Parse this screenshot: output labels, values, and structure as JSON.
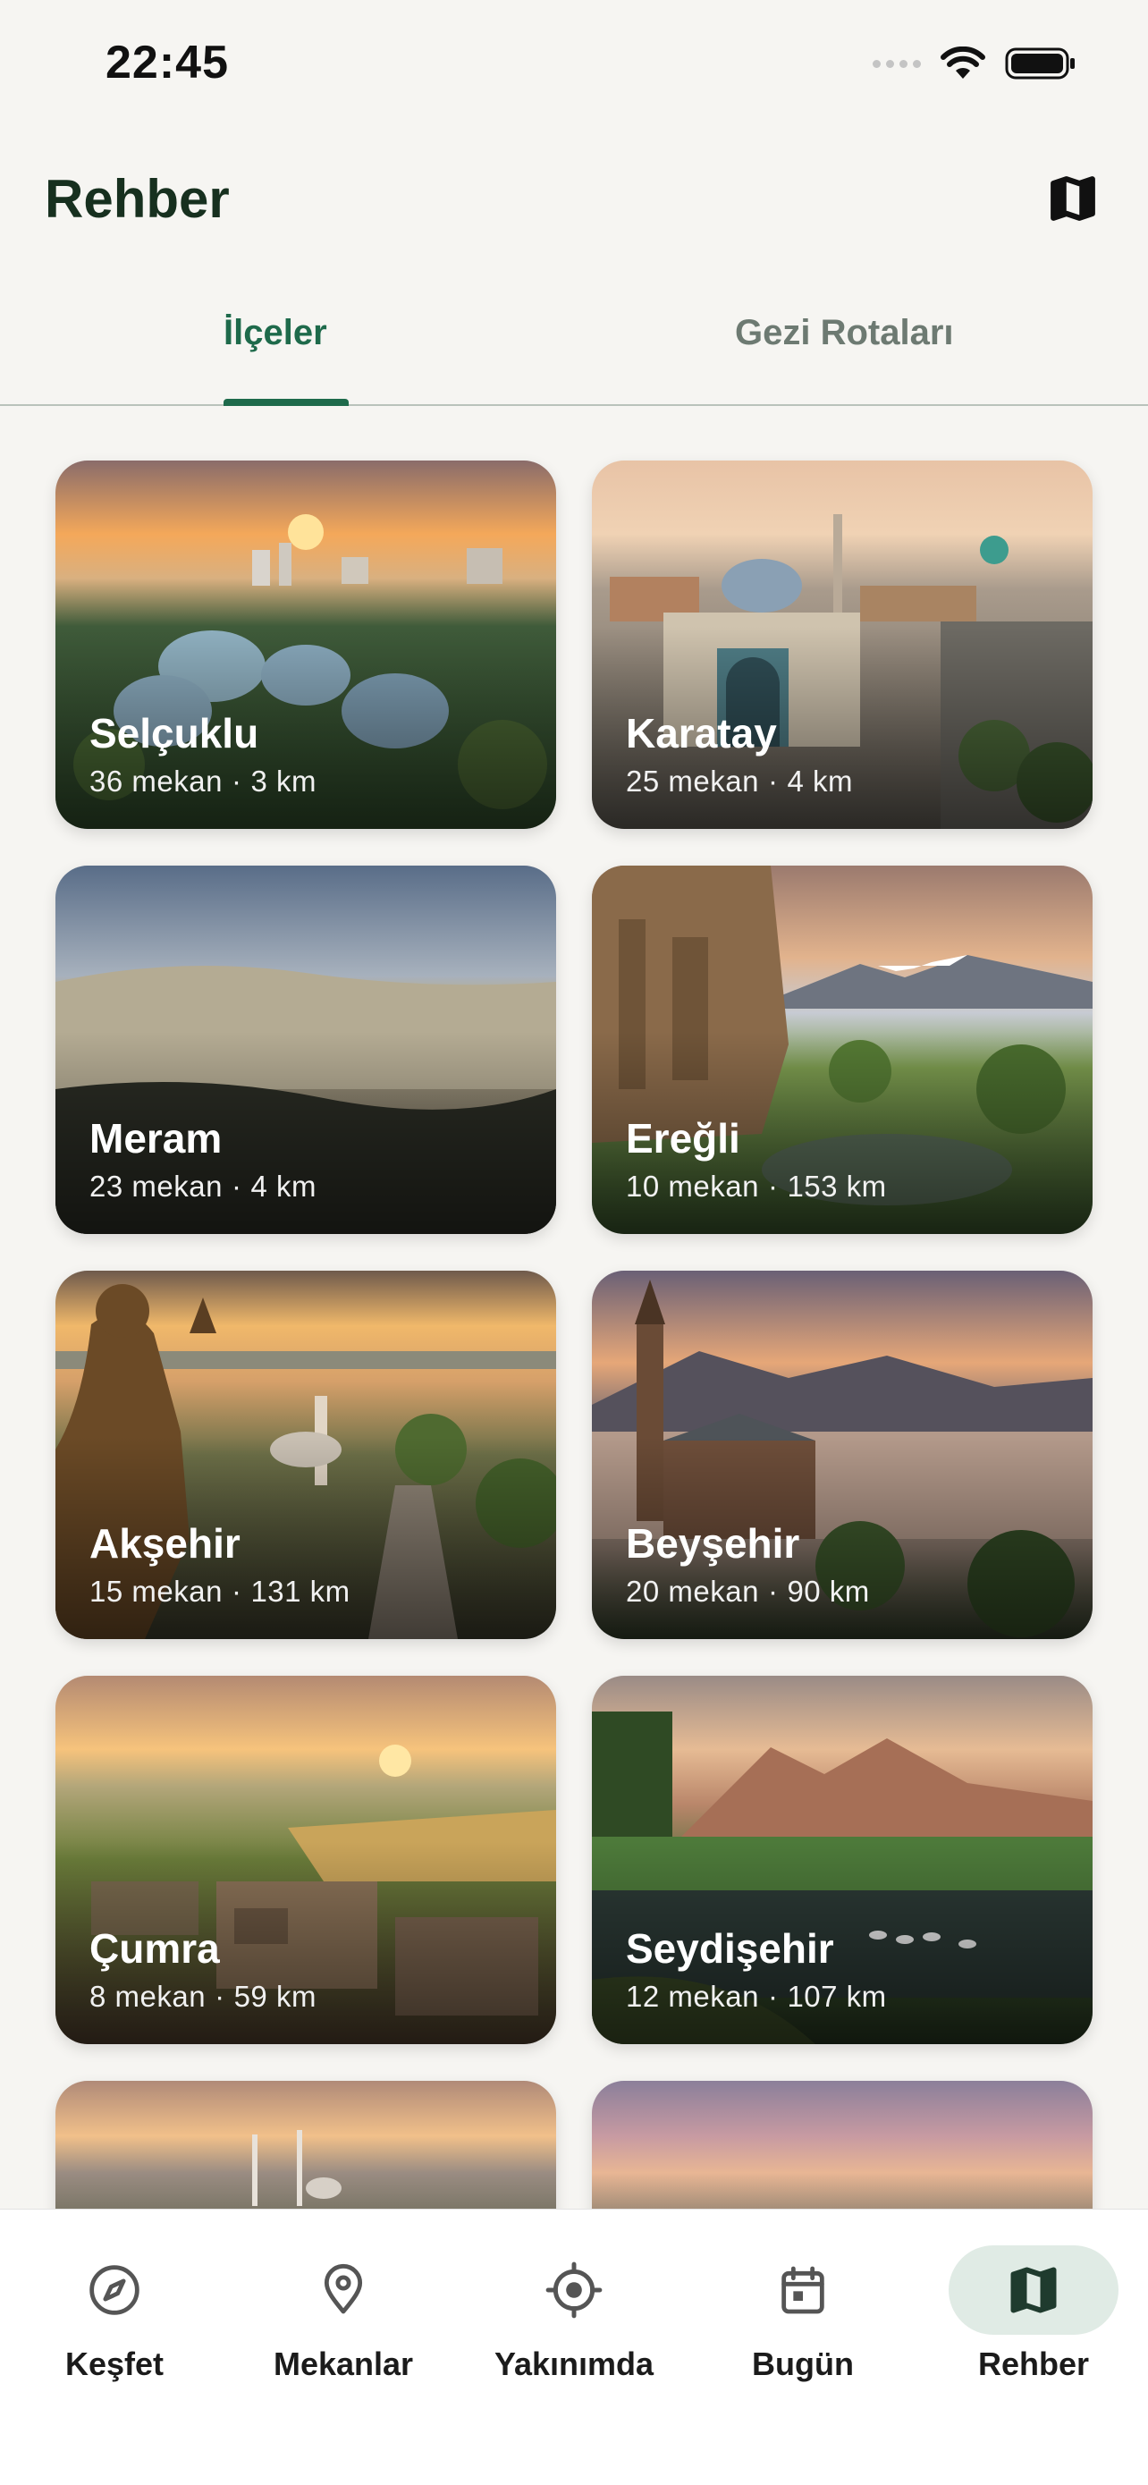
{
  "status_bar": {
    "time": "22:45"
  },
  "header": {
    "title": "Rehber"
  },
  "tabs": [
    {
      "label": "İlçeler",
      "active": true
    },
    {
      "label": "Gezi Rotaları",
      "active": false
    }
  ],
  "districts": [
    {
      "name": "Selçuklu",
      "places": "36 mekan",
      "distance": "3 km"
    },
    {
      "name": "Karatay",
      "places": "25 mekan",
      "distance": "4 km"
    },
    {
      "name": "Meram",
      "places": "23 mekan",
      "distance": "4 km"
    },
    {
      "name": "Ereğli",
      "places": "10 mekan",
      "distance": "153 km"
    },
    {
      "name": "Akşehir",
      "places": "15 mekan",
      "distance": "131 km"
    },
    {
      "name": "Beyşehir",
      "places": "20 mekan",
      "distance": "90 km"
    },
    {
      "name": "Çumra",
      "places": "8 mekan",
      "distance": "59 km"
    },
    {
      "name": "Seydişehir",
      "places": "12 mekan",
      "distance": "107 km"
    }
  ],
  "meta_separator": "·",
  "bottom_nav": [
    {
      "label": "Keşfet",
      "icon": "compass-icon"
    },
    {
      "label": "Mekanlar",
      "icon": "location-pin-icon"
    },
    {
      "label": "Yakınımda",
      "icon": "target-icon"
    },
    {
      "label": "Bugün",
      "icon": "calendar-icon"
    },
    {
      "label": "Rehber",
      "icon": "map-icon",
      "active": true
    }
  ],
  "colors": {
    "accent": "#1e6a4b",
    "background": "#f6f5f2",
    "nav_active_bg": "#e0ebe5"
  }
}
